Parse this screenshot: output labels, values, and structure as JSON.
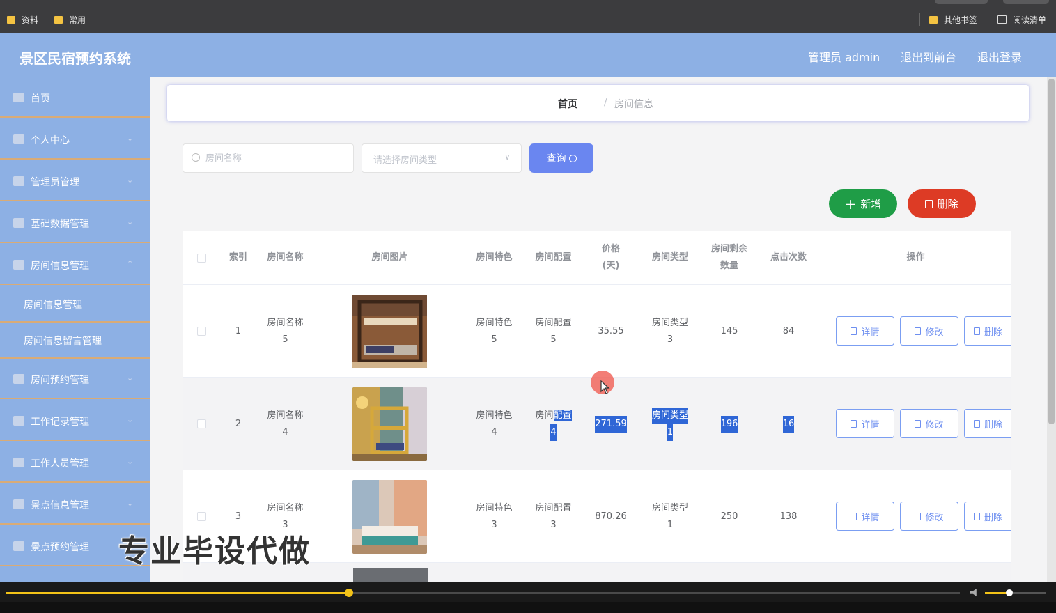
{
  "bookmarks": {
    "left": [
      {
        "label": "资料"
      },
      {
        "label": "常用"
      }
    ],
    "right": [
      {
        "label": "其他书签"
      },
      {
        "label": "阅读清单"
      }
    ]
  },
  "header": {
    "title": "景区民宿预约系统",
    "user": "管理员 admin",
    "front_link": "退出到前台",
    "logout_link": "退出登录"
  },
  "sidebar": {
    "items": [
      {
        "label": "首页",
        "icon": "home-icon"
      },
      {
        "label": "个人中心",
        "icon": "user-icon"
      },
      {
        "label": "管理员管理",
        "icon": "admin-icon"
      },
      {
        "label": "基础数据管理",
        "icon": "data-icon"
      },
      {
        "label": "房间信息管理",
        "icon": "list-icon"
      },
      {
        "label": "房间信息管理",
        "icon": ""
      },
      {
        "label": "房间信息留言管理",
        "icon": ""
      },
      {
        "label": "房间预约管理",
        "icon": "list-icon"
      },
      {
        "label": "工作记录管理",
        "icon": "record-icon"
      },
      {
        "label": "工作人员管理",
        "icon": "staff-icon"
      },
      {
        "label": "景点信息管理",
        "icon": "scenic-icon"
      },
      {
        "label": "景点预约管理",
        "icon": "list-icon"
      }
    ]
  },
  "breadcrumb": {
    "home": "首页",
    "separator": "/",
    "current": "房间信息"
  },
  "search": {
    "name_placeholder": "房间名称",
    "type_placeholder": "请选择房间类型",
    "query_label": "查询"
  },
  "toolbar": {
    "add_label": "新增",
    "delete_label": "删除"
  },
  "table": {
    "headers": {
      "index": "索引",
      "name": "房间名称",
      "image": "房间图片",
      "feature": "房间特色",
      "config": "房间配置",
      "price_1": "价格",
      "price_2": "(天)",
      "type": "房间类型",
      "remain_1": "房间剩余",
      "remain_2": "数量",
      "clicks": "点击次数",
      "ops": "操作"
    },
    "rows": [
      {
        "index": "1",
        "name_1": "房间名称",
        "name_2": "5",
        "feature_1": "房间特色",
        "feature_2": "5",
        "config_1": "房间配置",
        "config_2": "5",
        "price": "35.55",
        "type_1": "房间类型",
        "type_2": "3",
        "remain": "145",
        "clicks": "84"
      },
      {
        "index": "2",
        "name_1": "房间名称",
        "name_2": "4",
        "feature_1": "房间特色",
        "feature_2": "4",
        "config_1": "房间",
        "config_1b": "配置",
        "config_2": "4",
        "price": "271.59",
        "type_1": "房间类型",
        "type_2": "1",
        "remain": "196",
        "clicks": "16"
      },
      {
        "index": "3",
        "name_1": "房间名称",
        "name_2": "3",
        "feature_1": "房间特色",
        "feature_2": "3",
        "config_1": "房间配置",
        "config_2": "3",
        "price": "870.26",
        "type_1": "房间类型",
        "type_2": "1",
        "remain": "250",
        "clicks": "138"
      }
    ],
    "actions": {
      "detail": "详情",
      "edit": "修改",
      "delete": "删除"
    }
  },
  "watermark": "专业毕设代做",
  "player": {
    "progress": 0.36,
    "volume": 0.4
  }
}
